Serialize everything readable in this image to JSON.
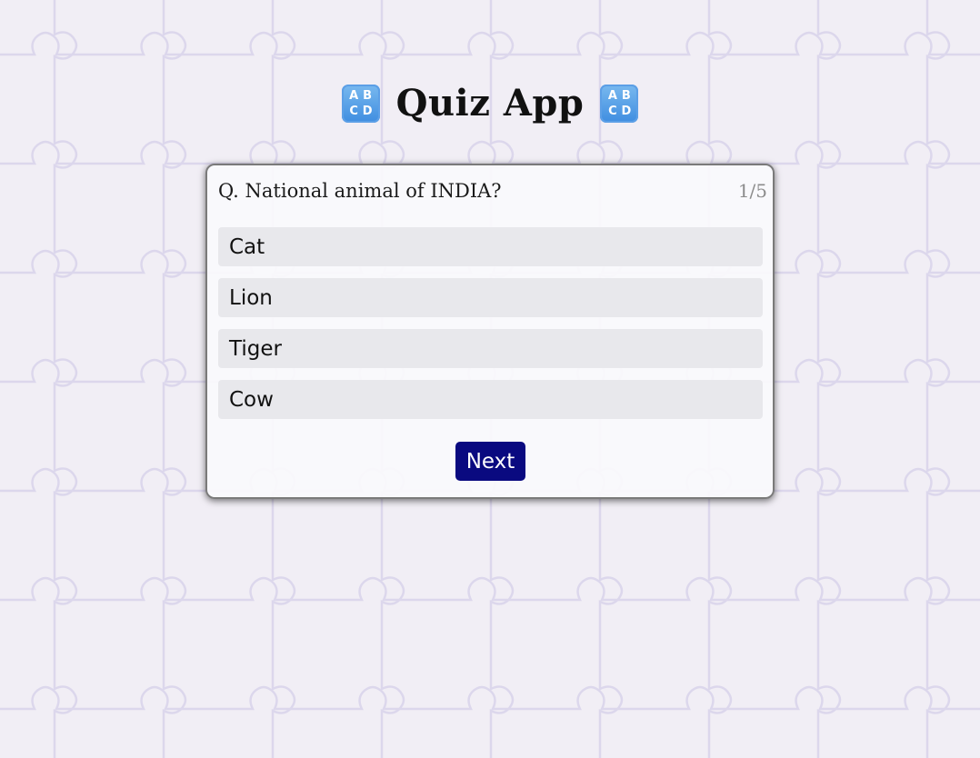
{
  "app": {
    "title": "Quiz App",
    "title_icon": "abcd-input-symbol-icon",
    "icon_letters": [
      "A",
      "B",
      "C",
      "D"
    ]
  },
  "quiz": {
    "question": "Q. National animal of INDIA?",
    "progress": "1/5",
    "options": [
      "Cat",
      "Lion",
      "Tiger",
      "Cow"
    ],
    "next_label": "Next"
  },
  "colors": {
    "background": "#f1eef5",
    "puzzle_lines": "#dcd7ec",
    "option_bg": "#e8e8ec",
    "next_button_bg": "#0a0a80",
    "next_button_text": "#ffffff",
    "icon_blue": "#4a93e2"
  },
  "background_pattern": "jigsaw-puzzle-pieces"
}
